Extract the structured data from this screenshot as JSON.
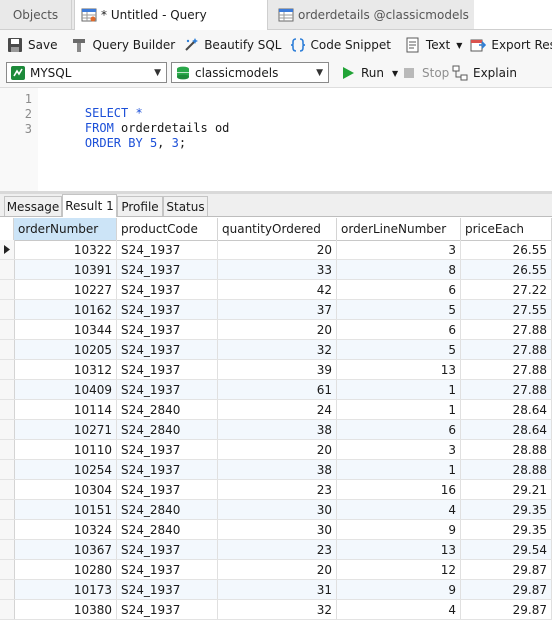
{
  "tabs": {
    "objects": "Objects",
    "query": "* Untitled - Query",
    "details": "orderdetails @classicmodels (..."
  },
  "toolbar": {
    "save": "Save",
    "query_builder": "Query Builder",
    "beautify": "Beautify SQL",
    "snippet": "Code Snippet",
    "text": "Text",
    "export": "Export Result"
  },
  "bar2": {
    "connection": "MYSQL",
    "database": "classicmodels",
    "run": "Run",
    "stop": "Stop",
    "explain": "Explain"
  },
  "editor": {
    "line_numbers": [
      "1",
      "2",
      "3"
    ],
    "line1_kw": "SELECT *",
    "line2_kw": "FROM",
    "line2_rest": " orderdetails od",
    "line3_kw": "ORDER BY",
    "line3_n1": "5",
    "line3_sep": ", ",
    "line3_n2": "3",
    "line3_end": ";"
  },
  "result_tabs": [
    "Message",
    "Result 1",
    "Profile",
    "Status"
  ],
  "grid": {
    "columns": [
      "orderNumber",
      "productCode",
      "quantityOrdered",
      "orderLineNumber",
      "priceEach"
    ],
    "rows": [
      [
        "10322",
        "S24_1937",
        "20",
        "3",
        "26.55"
      ],
      [
        "10391",
        "S24_1937",
        "33",
        "8",
        "26.55"
      ],
      [
        "10227",
        "S24_1937",
        "42",
        "6",
        "27.22"
      ],
      [
        "10162",
        "S24_1937",
        "37",
        "5",
        "27.55"
      ],
      [
        "10344",
        "S24_1937",
        "20",
        "6",
        "27.88"
      ],
      [
        "10205",
        "S24_1937",
        "32",
        "5",
        "27.88"
      ],
      [
        "10312",
        "S24_1937",
        "39",
        "13",
        "27.88"
      ],
      [
        "10409",
        "S24_1937",
        "61",
        "1",
        "27.88"
      ],
      [
        "10114",
        "S24_2840",
        "24",
        "1",
        "28.64"
      ],
      [
        "10271",
        "S24_2840",
        "38",
        "6",
        "28.64"
      ],
      [
        "10110",
        "S24_1937",
        "20",
        "3",
        "28.88"
      ],
      [
        "10254",
        "S24_1937",
        "38",
        "1",
        "28.88"
      ],
      [
        "10304",
        "S24_1937",
        "23",
        "16",
        "29.21"
      ],
      [
        "10151",
        "S24_2840",
        "30",
        "4",
        "29.35"
      ],
      [
        "10324",
        "S24_2840",
        "30",
        "9",
        "29.35"
      ],
      [
        "10367",
        "S24_1937",
        "23",
        "13",
        "29.54"
      ],
      [
        "10280",
        "S24_1937",
        "20",
        "12",
        "29.87"
      ],
      [
        "10173",
        "S24_1937",
        "31",
        "9",
        "29.87"
      ],
      [
        "10380",
        "S24_1937",
        "32",
        "4",
        "29.87"
      ]
    ]
  },
  "colors": {
    "keyword": "#1b4fd8",
    "selected_header": "#cce4f7",
    "run_green": "#21a336"
  }
}
